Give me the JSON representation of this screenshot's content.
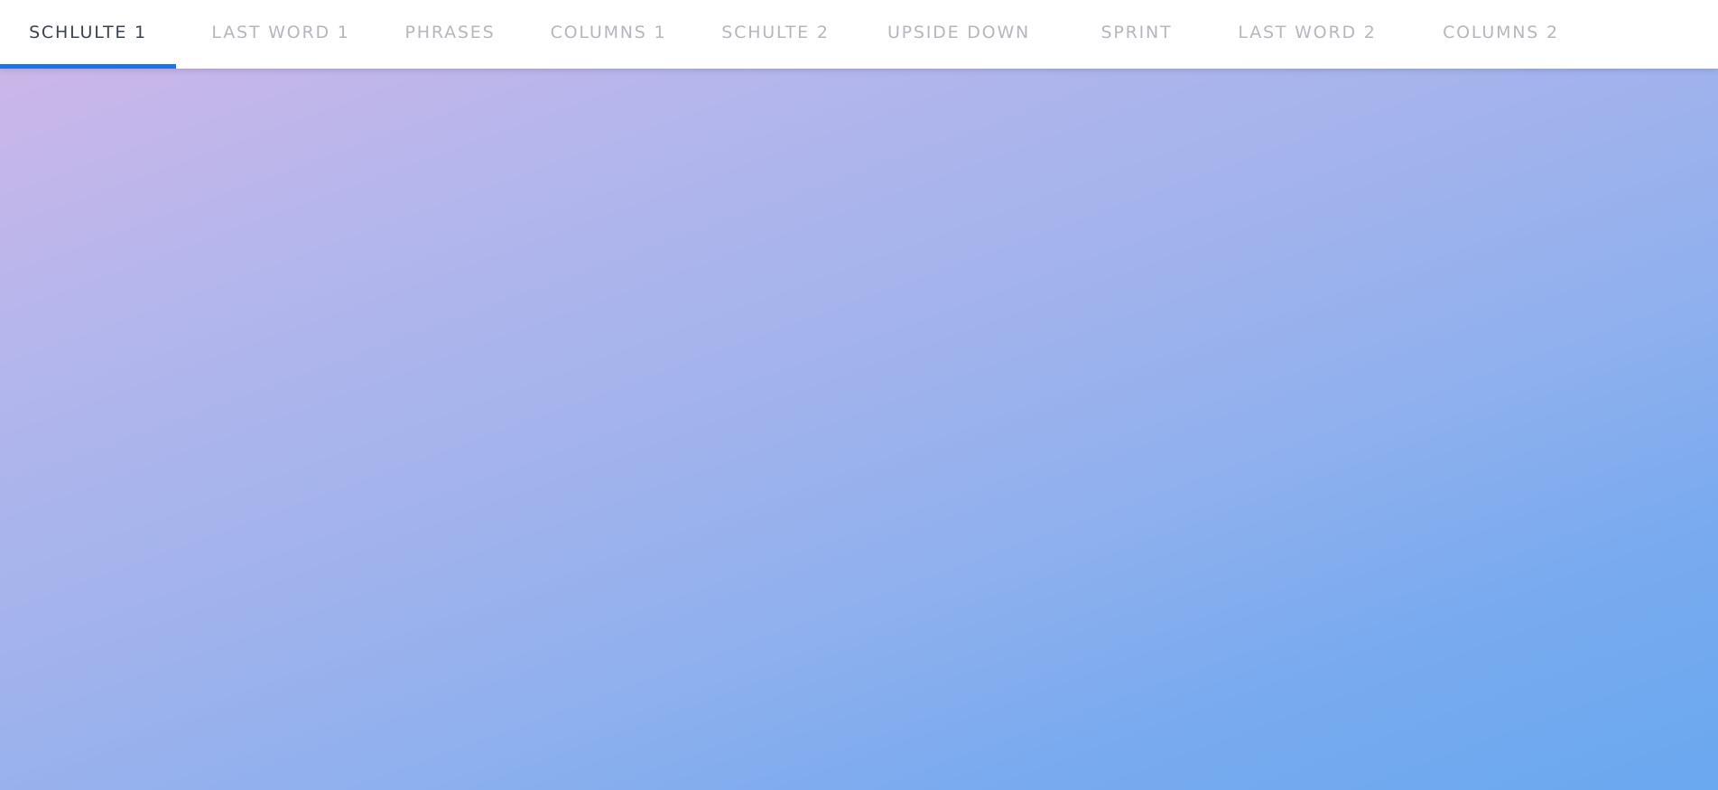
{
  "tabs": [
    {
      "label": "SCHLULTE 1",
      "active": true
    },
    {
      "label": "LAST WORD 1",
      "active": false
    },
    {
      "label": "PHRASES",
      "active": false
    },
    {
      "label": "COLUMNS 1",
      "active": false
    },
    {
      "label": "SCHULTE 2",
      "active": false
    },
    {
      "label": "UPSIDE DOWN",
      "active": false
    },
    {
      "label": "SPRINT",
      "active": false
    },
    {
      "label": "LAST WORD 2",
      "active": false
    },
    {
      "label": "COLUMNS 2",
      "active": false
    }
  ],
  "colors": {
    "active_indicator": "#1a73e8",
    "active_text": "#3c4350",
    "inactive_text": "#b5b7bf",
    "background_gradient_start": "#d2b6e8",
    "background_gradient_end": "#6aa8ef"
  }
}
